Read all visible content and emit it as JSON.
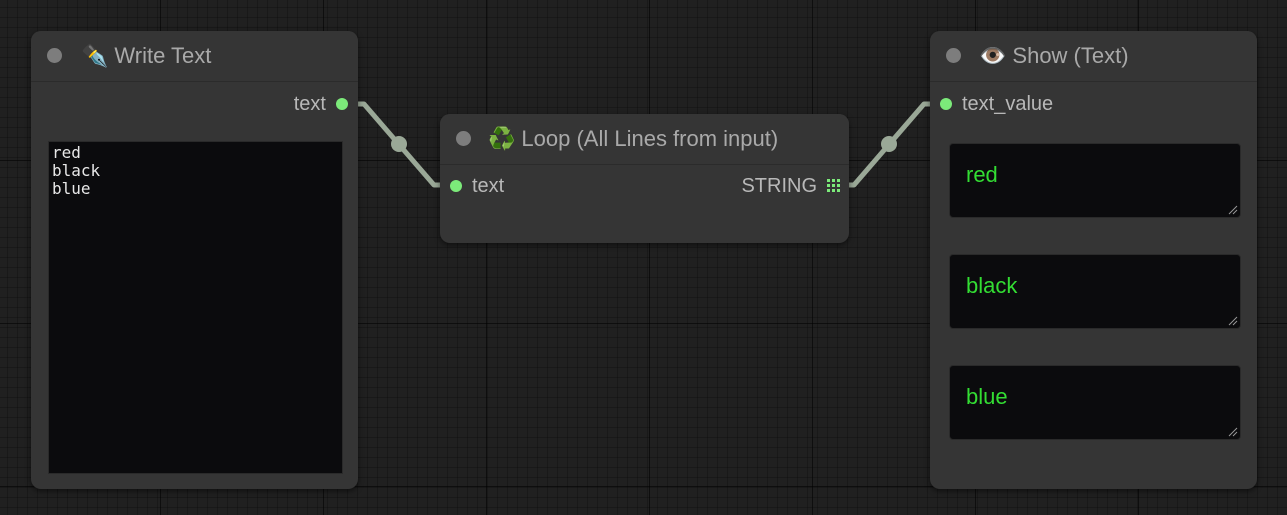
{
  "nodes": {
    "write_text": {
      "title": "Write Text",
      "icon": "pen-nib-icon",
      "icon_glyph": "✒️",
      "outputs": [
        {
          "label": "text"
        }
      ],
      "text_value": "red\nblack\nblue"
    },
    "loop": {
      "title": "Loop (All Lines from input)",
      "icon": "recycle-icon",
      "icon_glyph": "♻️",
      "inputs": [
        {
          "label": "text"
        }
      ],
      "outputs": [
        {
          "label": "STRING"
        }
      ]
    },
    "show_text": {
      "title": "Show (Text)",
      "icon": "eye-icon",
      "icon_glyph": "👁️",
      "inputs": [
        {
          "label": "text_value"
        }
      ],
      "values": [
        "red",
        "black",
        "blue"
      ]
    }
  },
  "colors": {
    "canvas_bg": "#202020",
    "node_bg": "#353535",
    "port_green": "#7cea7a",
    "link": "#9aa897",
    "output_text": "#33dd33"
  }
}
